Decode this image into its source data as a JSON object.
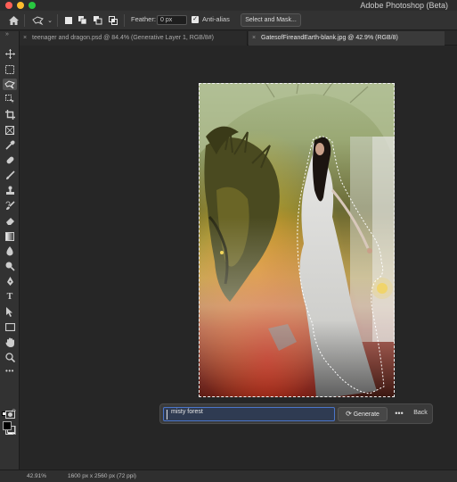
{
  "window": {
    "title": "Adobe Photoshop (Beta)"
  },
  "options_bar": {
    "home_icon": "home-icon",
    "lasso_icon": "lasso-icon",
    "feather_label": "Feather:",
    "feather_value": "0 px",
    "anti_alias_label": "Anti-alias",
    "anti_alias_checked": true,
    "select_mask_label": "Select and Mask..."
  },
  "tabs": [
    {
      "label": "teenager and dragon.psd @ 84.4% (Generative Layer 1, RGB/8#)",
      "active": false
    },
    {
      "label": "GatesofFireandEarth-blank.jpg @ 42.9% (RGB/8)",
      "active": true
    }
  ],
  "toolbar": {
    "tools": [
      "move-tool",
      "marquee-tool",
      "lasso-tool",
      "object-select-tool",
      "crop-tool",
      "frame-tool",
      "eyedropper-tool",
      "spot-heal-tool",
      "brush-tool",
      "stamp-tool",
      "history-brush-tool",
      "eraser-tool",
      "gradient-tool",
      "blur-tool",
      "dodge-tool",
      "pen-tool",
      "type-tool",
      "path-select-tool",
      "rectangle-tool",
      "hand-tool",
      "zoom-tool",
      "more-tools"
    ],
    "active_tool": "lasso-tool",
    "foreground_color": "#000000",
    "background_color": "#ffffff"
  },
  "context_bar": {
    "prompt_value": "misty forest",
    "generate_label": "Generate",
    "more_label": "•••",
    "back_label": "Back"
  },
  "status": {
    "zoom": "42.91%",
    "doc_size": "1600 px x 2560 px (72 ppi)"
  }
}
